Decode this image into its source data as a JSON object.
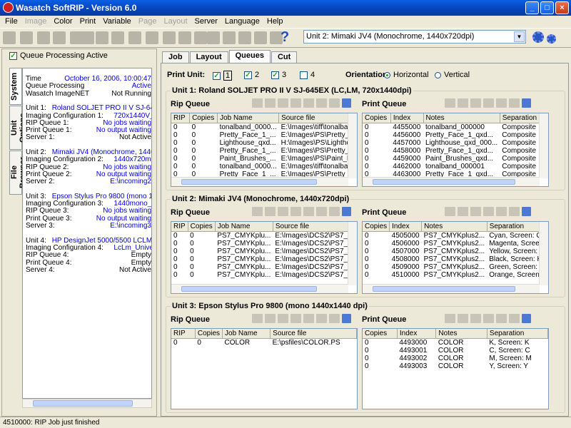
{
  "window": {
    "title": "Wasatch SoftRIP - Version 6.0"
  },
  "menu": [
    {
      "label": "File",
      "disabled": false
    },
    {
      "label": "Image",
      "disabled": true
    },
    {
      "label": "Color",
      "disabled": false
    },
    {
      "label": "Print",
      "disabled": false
    },
    {
      "label": "Variable",
      "disabled": false
    },
    {
      "label": "Page",
      "disabled": true
    },
    {
      "label": "Layout",
      "disabled": true
    },
    {
      "label": "Server",
      "disabled": false
    },
    {
      "label": "Language",
      "disabled": false
    },
    {
      "label": "Help",
      "disabled": false
    }
  ],
  "toolbar": {
    "unit_select": "Unit 2: Mimaki JV4 (Monochrome, 1440x720dpi)"
  },
  "left": {
    "queue_processing_active": "Queue Processing Active",
    "vtabs": [
      "System",
      "Unit Options",
      "File Browser"
    ],
    "system_lines": [
      {
        "l": "Time",
        "r": "October 16, 2006, 10:00:47",
        "rc": "blue"
      },
      {
        "l": "Queue Processing",
        "r": "Active",
        "rc": "blue"
      },
      {
        "l": "Wasatch ImageNET",
        "r": "Not Running",
        "rc": ""
      },
      {
        "l": "",
        "r": "",
        "rc": ""
      },
      {
        "l": "Unit 1:",
        "lb": "Roland  SOLJET PRO II V SJ-645EX ...",
        "r": "",
        "rc": ""
      },
      {
        "l": "Imaging Configuration 1:",
        "lb": "720x1440V_EcoSol...",
        "r": "",
        "rc": ""
      },
      {
        "l": "RIP Queue 1:",
        "r": "No jobs waiting",
        "rc": "blue"
      },
      {
        "l": "Print Queue 1:",
        "r": "No output waiting",
        "rc": "blue"
      },
      {
        "l": "Server 1:",
        "r": "Not Active",
        "rc": ""
      },
      {
        "l": "",
        "r": "",
        "rc": ""
      },
      {
        "l": "Unit 2:",
        "lb": "Mimaki  JV4 (Monochrome, 1440x720...",
        "r": "",
        "rc": ""
      },
      {
        "l": "Imaging Configuration 2:",
        "lb": "1440x720mono_Po...",
        "r": "",
        "rc": ""
      },
      {
        "l": "RIP Queue 2:",
        "r": "No jobs waiting",
        "rc": "blue"
      },
      {
        "l": "Print Queue 2:",
        "r": "No output waiting",
        "rc": "blue"
      },
      {
        "l": "Server 2:",
        "r": "E:\\incoming2",
        "rc": "blue"
      },
      {
        "l": "",
        "r": "",
        "rc": ""
      },
      {
        "l": "Unit 3:",
        "lb": "Epson  Stylus Pro 9800 (mono 1440x...",
        "r": "",
        "rc": ""
      },
      {
        "l": "Imaging Configuration 3:",
        "lb": "1440mono_WPRS_...",
        "r": "",
        "rc": ""
      },
      {
        "l": "RIP Queue 3:",
        "r": "No jobs waiting",
        "rc": "blue"
      },
      {
        "l": "Print Queue 3:",
        "r": "No output waiting",
        "rc": "blue"
      },
      {
        "l": "Server 3:",
        "r": "E:\\incoming3",
        "rc": "blue"
      },
      {
        "l": "",
        "r": "",
        "rc": ""
      },
      {
        "l": "Unit 4:",
        "lb": "HP  DesignJet 5000/5500 LCLM (Nor...",
        "r": "",
        "rc": ""
      },
      {
        "l": "Imaging Configuration 4:",
        "lb": "LcLm_Universal_Hi...",
        "r": "",
        "rc": ""
      },
      {
        "l": "RIP Queue 4:",
        "r": "Empty",
        "rc": ""
      },
      {
        "l": "Print Queue 4:",
        "r": "Empty",
        "rc": ""
      },
      {
        "l": "Server 4:",
        "r": "Not Active",
        "rc": ""
      }
    ]
  },
  "tabs": [
    "Job",
    "Layout",
    "Queues",
    "Cut"
  ],
  "print_unit": {
    "label": "Print Unit:",
    "units": [
      "1",
      "2",
      "3",
      "4"
    ],
    "orientation_label": "Orientation:",
    "horizontal": "Horizontal",
    "vertical": "Vertical"
  },
  "rip_label": "Rip Queue",
  "print_label": "Print Queue",
  "groups": [
    {
      "title": "Unit 1: Roland  SOLJET PRO II V SJ-645EX (LC,LM, 720x1440dpi)",
      "rip_cols": [
        "RIP",
        "Copies",
        "Job Name",
        "Source file"
      ],
      "rip_rows": [
        [
          "0",
          "0",
          "tonalband_0000...",
          "E:\\Images\\tiff\\tonalbar"
        ],
        [
          "0",
          "0",
          "Pretty_Face_1_...",
          "E:\\Images\\PS\\Pretty_"
        ],
        [
          "0",
          "0",
          "Lighthouse_qxd...",
          "H:\\Images\\PS\\Lighthou"
        ],
        [
          "0",
          "0",
          "Pretty_Face_1_...",
          "E:\\Images\\PS\\Pretty_"
        ],
        [
          "0",
          "0",
          "Paint_Brushes_...",
          "E:\\Images\\PS\\Paint_E"
        ],
        [
          "0",
          "0",
          "tonalband_0000...",
          "E:\\Images\\tiff\\tonalbar"
        ],
        [
          "0",
          "0",
          "Pretty_Face_1_...",
          "E:\\Images\\PS\\Pretty_"
        ]
      ],
      "print_cols": [
        "Copies",
        "Index",
        "Notes",
        "Separation"
      ],
      "print_rows": [
        [
          "0",
          "4455000",
          "tonalband_000000",
          "Composite"
        ],
        [
          "0",
          "4456000",
          "Pretty_Face_1_qxd...",
          "Composite"
        ],
        [
          "0",
          "4457000",
          "Lighthouse_qxd_000...",
          "Composite"
        ],
        [
          "0",
          "4458000",
          "Pretty_Face_1_qxd...",
          "Composite"
        ],
        [
          "0",
          "4459000",
          "Paint_Brushes_qxd...",
          "Composite"
        ],
        [
          "0",
          "4462000",
          "tonalband_000001",
          "Composite"
        ],
        [
          "0",
          "4463000",
          "Pretty_Face_1_qxd...",
          "Composite"
        ]
      ]
    },
    {
      "title": "Unit 2: Mimaki  JV4 (Monochrome, 1440x720dpi)",
      "rip_cols": [
        "RIP",
        "Copies",
        "Job Name",
        "Source file"
      ],
      "rip_rows": [
        [
          "0",
          "0",
          "PS7_CMYKplu...",
          "E:\\Images\\DCS2\\PS7_CMYKp"
        ],
        [
          "0",
          "0",
          "PS7_CMYKplu...",
          "E:\\Images\\DCS2\\PS7_CMYKp"
        ],
        [
          "0",
          "0",
          "PS7_CMYKplu...",
          "E:\\Images\\DCS2\\PS7_CMYKp"
        ],
        [
          "0",
          "0",
          "PS7_CMYKplu...",
          "E:\\Images\\DCS2\\PS7_CMYKp"
        ],
        [
          "0",
          "0",
          "PS7_CMYKplu...",
          "E:\\Images\\DCS2\\PS7_CMYKp"
        ],
        [
          "0",
          "0",
          "PS7_CMYKplu...",
          "E:\\Images\\DCS2\\PS7_CMYKp"
        ]
      ],
      "print_cols": [
        "Copies",
        "Index",
        "Notes",
        "Separation"
      ],
      "print_rows": [
        [
          "0",
          "4505000",
          "PS7_CMYKplus2...",
          "Cyan, Screen: C"
        ],
        [
          "0",
          "4506000",
          "PS7_CMYKplus2...",
          "Magenta, Screen: M"
        ],
        [
          "0",
          "4507000",
          "PS7_CMYKplus2...",
          "Yellow, Screen: Y"
        ],
        [
          "0",
          "4508000",
          "PS7_CMYKplus2...",
          "Black, Screen: K"
        ],
        [
          "0",
          "4509000",
          "PS7_CMYKplus2...",
          "Green, Screen: D"
        ],
        [
          "0",
          "4510000",
          "PS7_CMYKplus2...",
          "Orange, Screen: D"
        ]
      ]
    },
    {
      "title": "Unit 3: Epson  Stylus Pro 9800 (mono 1440x1440 dpi)",
      "rip_cols": [
        "RIP",
        "Copies",
        "Job Name",
        "Source file"
      ],
      "rip_rows": [
        [
          "0",
          "0",
          "COLOR",
          "E:\\psfiles\\COLOR.PS"
        ]
      ],
      "print_cols": [
        "Copies",
        "Index",
        "Notes",
        "Separation"
      ],
      "print_rows": [
        [
          "0",
          "4493000",
          "COLOR",
          "K, Screen: K"
        ],
        [
          "0",
          "4493001",
          "COLOR",
          "C, Screen: C"
        ],
        [
          "0",
          "4493002",
          "COLOR",
          "M, Screen: M"
        ],
        [
          "0",
          "4493003",
          "COLOR",
          "Y, Screen: Y"
        ]
      ]
    }
  ],
  "status": "4510000: RIP Job just finished"
}
